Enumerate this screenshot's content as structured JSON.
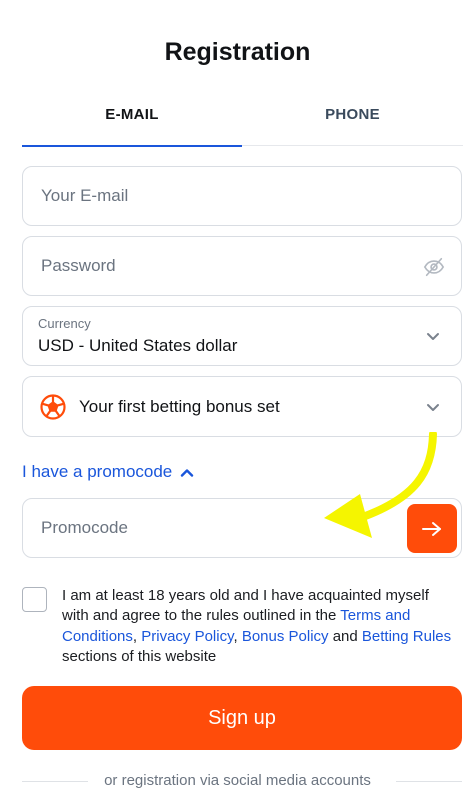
{
  "title": "Registration",
  "tabs": [
    {
      "label": "E-MAIL",
      "active": true
    },
    {
      "label": "PHONE",
      "active": false
    }
  ],
  "form": {
    "email_placeholder": "Your E-mail",
    "password_placeholder": "Password",
    "currency": {
      "label": "Currency",
      "value": "USD - United States dollar"
    },
    "bonus": {
      "label": "Your first betting bonus set",
      "icon": "soccer-ball-icon"
    },
    "promo_toggle_label": "I have a promocode",
    "promo_placeholder": "Promocode",
    "terms": {
      "prefix": "I am at least 18 years old and I have acquainted myself with and agree to the rules outlined in the",
      "link_terms": "Terms and Conditions",
      "sep1": ",",
      "link_privacy": "Privacy Policy",
      "sep2": ",",
      "link_bonus": "Bonus Policy",
      "and": "and",
      "link_betting": "Betting Rules",
      "suffix": "sections of this website"
    },
    "signup_label": "Sign up",
    "social_label": "or registration via social media accounts"
  },
  "colors": {
    "accent": "#ff4c0a",
    "link": "#1a56db",
    "highlight_arrow": "#f5f500"
  }
}
